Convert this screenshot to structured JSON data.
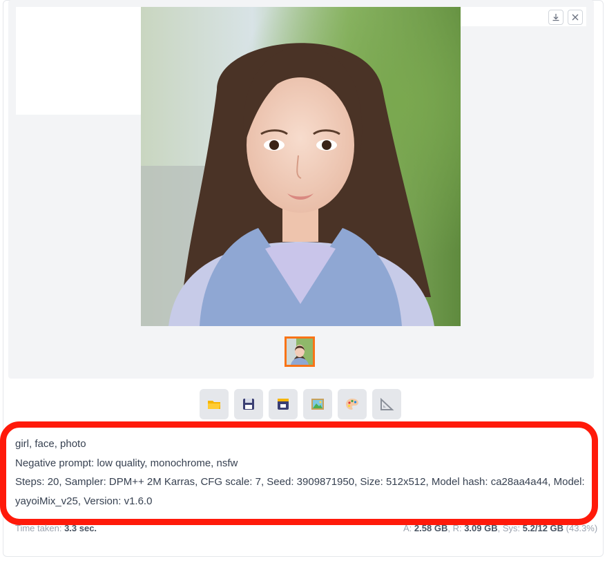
{
  "gallery": {
    "download_icon": "download-icon",
    "close_icon": "close-icon"
  },
  "toolbar": {
    "buttons": [
      {
        "icon": "folder-icon"
      },
      {
        "icon": "save-icon"
      },
      {
        "icon": "zip-save-icon"
      },
      {
        "icon": "send-to-img2img-icon"
      },
      {
        "icon": "send-to-inpaint-icon"
      },
      {
        "icon": "send-to-extras-icon"
      }
    ]
  },
  "generation_info": {
    "prompt": "girl, face, photo",
    "negative_prompt": "Negative prompt: low quality, monochrome, nsfw",
    "params_line1": "Steps: 20, Sampler: DPM++ 2M Karras, CFG scale: 7, Seed: 3909871950, Size: 512x512, Model hash: ca28aa4a44, Model:",
    "params_line2": "yayoiMix_v25, Version: v1.6.0"
  },
  "footer": {
    "time_label": "Time taken:",
    "time_value": "3.3 sec.",
    "vram_a_label": "A:",
    "vram_a_value": "2.58 GB",
    "vram_r_label": "R:",
    "vram_r_value": "3.09 GB",
    "vram_sys_label": "Sys:",
    "vram_sys_value": "5.2/12 GB",
    "vram_pct": "(43.3%)"
  },
  "colors": {
    "highlight": "#ff1a0a",
    "thumb_border": "#f97316"
  }
}
